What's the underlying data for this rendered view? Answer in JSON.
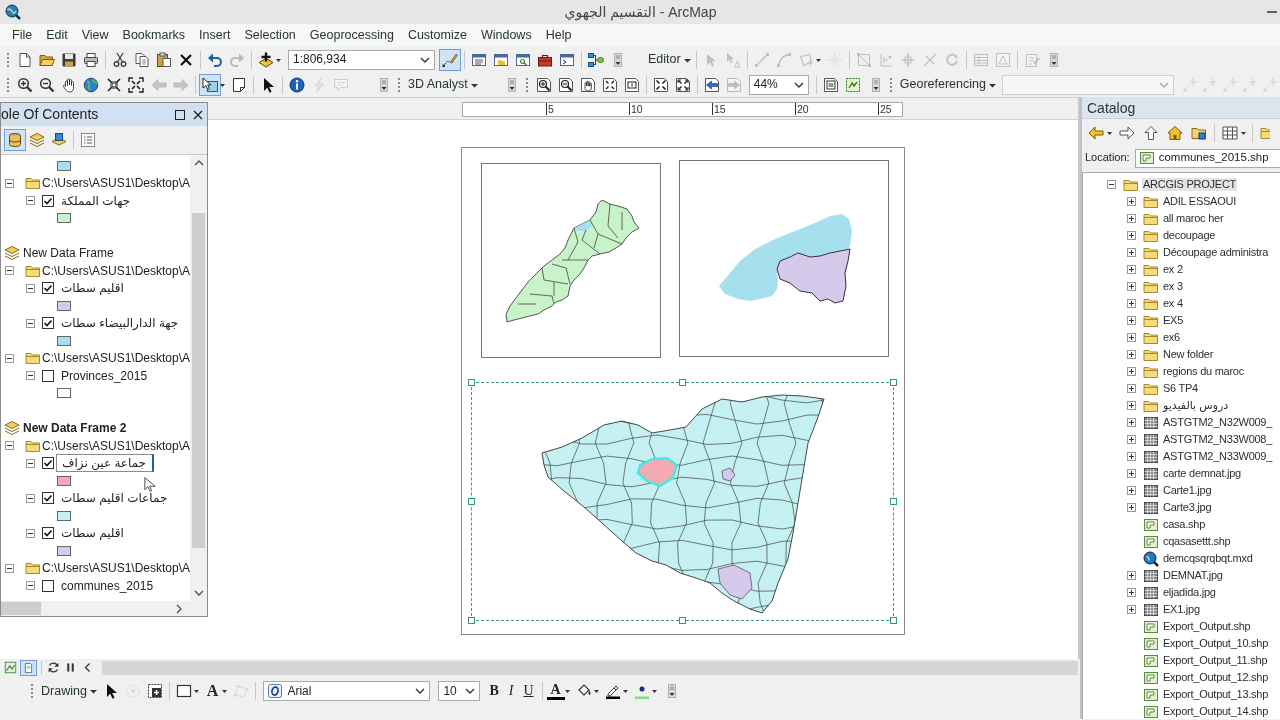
{
  "window": {
    "title": "التقسيم الجهوي - ArcMap"
  },
  "menu": [
    "File",
    "Edit",
    "View",
    "Bookmarks",
    "Insert",
    "Selection",
    "Geoprocessing",
    "Customize",
    "Windows",
    "Help"
  ],
  "toolbars": [
    {
      "items": [
        {
          "kind": "button",
          "disabled": false,
          "selected": false
        },
        {
          "kind": "button",
          "disabled": false,
          "selected": false
        },
        {
          "kind": "button",
          "disabled": false,
          "selected": false
        },
        {
          "kind": "button",
          "disabled": false,
          "selected": false
        },
        {
          "kind": "button",
          "disabled": false,
          "selected": false
        },
        {
          "kind": "button",
          "disabled": false,
          "selected": false
        },
        {
          "kind": "button",
          "disabled": false,
          "selected": false
        },
        {
          "kind": "button",
          "disabled": false,
          "selected": false
        },
        {
          "kind": "button",
          "disabled": false,
          "selected": false
        },
        {
          "kind": "button",
          "disabled": true,
          "selected": false
        },
        {
          "kind": "button",
          "disabled": false,
          "selected": false
        },
        {
          "kind": "combo",
          "value": "1:806,934",
          "disabled": false
        },
        {
          "kind": "button",
          "disabled": false,
          "selected": true
        },
        {
          "kind": "button",
          "disabled": false,
          "selected": false
        },
        {
          "kind": "button",
          "disabled": false,
          "selected": false
        },
        {
          "kind": "button",
          "disabled": false,
          "selected": false
        },
        {
          "kind": "button",
          "disabled": false,
          "selected": false
        },
        {
          "kind": "button",
          "disabled": false,
          "selected": false
        },
        {
          "kind": "button",
          "disabled": false,
          "selected": false
        },
        {
          "kind": "button",
          "disabled": false,
          "selected": false
        },
        {
          "kind": "menu",
          "label": "Editor"
        },
        {
          "kind": "button",
          "disabled": true,
          "selected": false
        },
        {
          "kind": "button",
          "disabled": true,
          "selected": false
        },
        {
          "kind": "button",
          "disabled": true,
          "selected": false
        },
        {
          "kind": "button",
          "disabled": true,
          "selected": false
        },
        {
          "kind": "button",
          "disabled": true,
          "selected": false
        },
        {
          "kind": "button",
          "disabled": true,
          "selected": false
        },
        {
          "kind": "button",
          "disabled": true,
          "selected": false
        },
        {
          "kind": "button",
          "disabled": true,
          "selected": false
        },
        {
          "kind": "button",
          "disabled": true,
          "selected": false
        },
        {
          "kind": "button",
          "disabled": true,
          "selected": false
        },
        {
          "kind": "button",
          "disabled": true,
          "selected": false
        },
        {
          "kind": "button",
          "disabled": true,
          "selected": false
        },
        {
          "kind": "button",
          "disabled": true,
          "selected": false
        },
        {
          "kind": "button",
          "disabled": true,
          "selected": false
        },
        {
          "kind": "button",
          "disabled": false,
          "selected": false
        }
      ]
    },
    {
      "items": [
        {
          "kind": "button",
          "disabled": false,
          "selected": false
        },
        {
          "kind": "button",
          "disabled": false,
          "selected": false
        },
        {
          "kind": "button",
          "disabled": false,
          "selected": false
        },
        {
          "kind": "button",
          "disabled": false,
          "selected": false
        },
        {
          "kind": "button",
          "disabled": false,
          "selected": false
        },
        {
          "kind": "button",
          "disabled": false,
          "selected": false
        },
        {
          "kind": "button",
          "disabled": true,
          "selected": false
        },
        {
          "kind": "button",
          "disabled": true,
          "selected": false
        },
        {
          "kind": "button",
          "disabled": false,
          "selected": true
        },
        {
          "kind": "button",
          "disabled": false,
          "selected": false
        },
        {
          "kind": "button",
          "disabled": false,
          "selected": false
        },
        {
          "kind": "button",
          "disabled": false,
          "selected": false
        },
        {
          "kind": "button",
          "disabled": true,
          "selected": false
        },
        {
          "kind": "button",
          "disabled": true,
          "selected": false
        },
        {
          "kind": "button",
          "disabled": false,
          "selected": false
        },
        {
          "kind": "menu",
          "label": "3D Analyst"
        },
        {
          "kind": "button",
          "disabled": false,
          "selected": false
        },
        {
          "kind": "button",
          "disabled": false,
          "selected": false
        },
        {
          "kind": "button",
          "disabled": false,
          "selected": false
        },
        {
          "kind": "button",
          "disabled": false,
          "selected": false
        },
        {
          "kind": "button",
          "disabled": false,
          "selected": false
        },
        {
          "kind": "button",
          "disabled": false,
          "selected": false
        },
        {
          "kind": "button",
          "disabled": false,
          "selected": false
        },
        {
          "kind": "button",
          "disabled": false,
          "selected": false
        },
        {
          "kind": "button",
          "disabled": false,
          "selected": false
        },
        {
          "kind": "button",
          "disabled": true,
          "selected": false
        },
        {
          "kind": "combo",
          "value": "44%",
          "disabled": false
        },
        {
          "kind": "button",
          "disabled": false,
          "selected": false
        },
        {
          "kind": "button",
          "disabled": false,
          "selected": false
        },
        {
          "kind": "button",
          "disabled": false,
          "selected": false
        },
        {
          "kind": "menu",
          "label": "Georeferencing"
        },
        {
          "kind": "combo",
          "disabled": true
        },
        {
          "kind": "button",
          "disabled": true,
          "selected": false
        },
        {
          "kind": "button",
          "disabled": true,
          "selected": false
        },
        {
          "kind": "button",
          "disabled": true,
          "selected": false
        },
        {
          "kind": "button",
          "disabled": true,
          "selected": false
        },
        {
          "kind": "button",
          "disabled": true,
          "selected": false
        }
      ]
    }
  ],
  "toc": {
    "title": "ole Of Contents",
    "toolbar": [
      {
        "kind": "button",
        "disabled": false,
        "selected": true
      },
      {
        "kind": "button",
        "disabled": false,
        "selected": false
      },
      {
        "kind": "button",
        "disabled": false,
        "selected": false
      },
      {
        "kind": "button",
        "disabled": false,
        "selected": false
      }
    ],
    "items": [
      {
        "kind": "frame",
        "children": [
          {
            "kind": "folder",
            "children": [
              {
                "kind": "layer",
                "color": "#a6e0ef"
              }
            ]
          },
          {
            "kind": "folder",
            "label": "C:\\Users\\ASUS1\\Desktop\\A",
            "expanded": true,
            "children": [
              {
                "kind": "layer",
                "label": "جهات المملكة",
                "checked": true,
                "expanded": true,
                "editing": false,
                "color": "#c8f2c8"
              }
            ]
          }
        ]
      },
      {
        "kind": "frame",
        "label": "New Data Frame",
        "active": false,
        "children": [
          {
            "kind": "folder",
            "label": "C:\\Users\\ASUS1\\Desktop\\A",
            "expanded": true,
            "children": [
              {
                "kind": "layer",
                "label": "اقليم سطات",
                "checked": true,
                "expanded": true,
                "editing": false,
                "color": "#d6caec"
              },
              {
                "kind": "layer",
                "label": "جهة الدارالبيضاء سطات",
                "checked": true,
                "expanded": true,
                "editing": false,
                "color": "#a6e0ef"
              }
            ]
          },
          {
            "kind": "folder",
            "label": "C:\\Users\\ASUS1\\Desktop\\A",
            "expanded": true,
            "children": [
              {
                "kind": "layer",
                "label": "Provinces_2015",
                "checked": false,
                "expanded": true,
                "editing": false,
                "color": "#ffffff"
              }
            ]
          }
        ]
      },
      {
        "kind": "frame",
        "label": "New Data Frame 2",
        "active": true,
        "children": [
          {
            "kind": "folder",
            "label": "C:\\Users\\ASUS1\\Desktop\\A",
            "expanded": true,
            "children": [
              {
                "kind": "layer",
                "label": "جماعة عين نزاف",
                "checked": true,
                "expanded": true,
                "editing": true,
                "color": "#f2aab3"
              },
              {
                "kind": "layer",
                "label": "جماعات اقليم سطات",
                "checked": true,
                "expanded": true,
                "editing": false,
                "color": "#c6f1f3"
              },
              {
                "kind": "layer",
                "label": "اقليم سطات",
                "checked": true,
                "expanded": true,
                "editing": false,
                "color": "#d6caec"
              }
            ]
          },
          {
            "kind": "folder",
            "label": "C:\\Users\\ASUS1\\Desktop\\A",
            "expanded": true,
            "children": [
              {
                "kind": "layer",
                "label": "communes_2015",
                "checked": false,
                "expanded": true,
                "editing": false
              }
            ]
          }
        ]
      }
    ]
  },
  "layout": {
    "ruler": [
      "5",
      "10",
      "15",
      "20",
      "25"
    ],
    "frames": [
      {
        "selected": false
      },
      {
        "selected": false
      },
      {
        "selected": true
      }
    ]
  },
  "view_bar": {
    "items": [
      {
        "kind": "button",
        "disabled": false,
        "selected": false
      },
      {
        "kind": "button",
        "disabled": false,
        "selected": true
      },
      {
        "kind": "button",
        "disabled": false,
        "selected": false
      },
      {
        "kind": "button",
        "disabled": false,
        "selected": false
      },
      {
        "kind": "button",
        "disabled": false,
        "selected": false
      }
    ]
  },
  "drawing_toolbar": {
    "items": [
      {
        "kind": "menu",
        "label": "Drawing"
      },
      {
        "kind": "button",
        "disabled": false,
        "selected": false
      },
      {
        "kind": "button",
        "disabled": true,
        "selected": false
      },
      {
        "kind": "button",
        "disabled": false,
        "selected": false
      },
      {
        "kind": "button",
        "disabled": false,
        "selected": false
      },
      {
        "kind": "text_button",
        "label": "A",
        "disabled": false,
        "selected": false
      },
      {
        "kind": "button",
        "disabled": true,
        "selected": false
      },
      {
        "kind": "combo",
        "value": "Arial",
        "disabled": false
      },
      {
        "kind": "combo",
        "value": "10",
        "disabled": false
      },
      {
        "kind": "text_button",
        "label": "B",
        "disabled": false,
        "selected": false
      },
      {
        "kind": "text_button",
        "label": "I",
        "disabled": false,
        "selected": false
      },
      {
        "kind": "text_button",
        "label": "U",
        "disabled": false,
        "selected": false
      },
      {
        "kind": "text_button",
        "label": "A",
        "disabled": false,
        "selected": false,
        "color": "#000000"
      },
      {
        "kind": "button",
        "disabled": false,
        "selected": false
      },
      {
        "kind": "button",
        "disabled": false,
        "selected": false,
        "color": "#000000"
      },
      {
        "kind": "button",
        "disabled": false,
        "selected": false,
        "color": "#7ee07a"
      },
      {
        "kind": "button",
        "disabled": false,
        "selected": false
      }
    ]
  },
  "catalog": {
    "title": "Catalog",
    "toolbar": [
      {
        "kind": "button",
        "disabled": false,
        "selected": false
      },
      {
        "kind": "button",
        "disabled": false,
        "selected": false
      },
      {
        "kind": "button",
        "disabled": false,
        "selected": false
      },
      {
        "kind": "button",
        "disabled": false,
        "selected": false
      },
      {
        "kind": "button",
        "disabled": false,
        "selected": false
      },
      {
        "kind": "button",
        "disabled": false,
        "selected": false
      },
      {
        "kind": "button",
        "disabled": false,
        "selected": false
      }
    ],
    "location_label": "Location:",
    "location": "communes_2015.shp",
    "tree": [
      {
        "kind": "folder",
        "label": "ARCGIS PROJECT",
        "expanded": true,
        "selected": true,
        "children": [
          {
            "kind": "folder",
            "label": "ADIL ESSAOUI",
            "expanded": false,
            "selected": false
          },
          {
            "kind": "folder",
            "label": "all maroc her",
            "expanded": false,
            "selected": false
          },
          {
            "kind": "folder",
            "label": "decoupage",
            "expanded": false,
            "selected": false
          },
          {
            "kind": "folder",
            "label": "Découpage administra",
            "expanded": false,
            "selected": false
          },
          {
            "kind": "folder",
            "label": "ex 2",
            "expanded": false,
            "selected": false
          },
          {
            "kind": "folder",
            "label": "ex 3",
            "expanded": false,
            "selected": false
          },
          {
            "kind": "folder",
            "label": "ex 4",
            "expanded": false,
            "selected": false
          },
          {
            "kind": "folder",
            "label": "EX5",
            "expanded": false,
            "selected": false
          },
          {
            "kind": "folder",
            "label": "ex6",
            "expanded": false,
            "selected": false
          },
          {
            "kind": "folder",
            "label": "New folder",
            "expanded": false,
            "selected": false
          },
          {
            "kind": "folder",
            "label": "regions du maroc",
            "expanded": false,
            "selected": false
          },
          {
            "kind": "folder",
            "label": "S6 TP4",
            "expanded": false,
            "selected": false
          },
          {
            "kind": "folder",
            "label": "دروس بالفيديو",
            "expanded": false,
            "selected": false
          },
          {
            "kind": "raster",
            "label": "ASTGTM2_N32W009_",
            "expanded": false,
            "selected": false
          },
          {
            "kind": "raster",
            "label": "ASTGTM2_N33W008_",
            "expanded": false,
            "selected": false
          },
          {
            "kind": "raster",
            "label": "ASTGTM2_N33W009_",
            "expanded": false,
            "selected": false
          },
          {
            "kind": "raster",
            "label": "carte demnat.jpg",
            "expanded": false,
            "selected": false
          },
          {
            "kind": "raster",
            "label": "Carte1.jpg",
            "expanded": false,
            "selected": false
          },
          {
            "kind": "raster",
            "label": "Carte3.jpg",
            "expanded": false,
            "selected": false
          },
          {
            "kind": "shapefile",
            "label": "casa.shp",
            "selected": false
          },
          {
            "kind": "shapefile",
            "label": "cqasasettt.shp",
            "selected": false
          },
          {
            "kind": "map_document",
            "label": "demcqsqrqbqt.mxd",
            "selected": false
          },
          {
            "kind": "raster",
            "label": "DEMNAT.jpg",
            "expanded": false,
            "selected": false
          },
          {
            "kind": "raster",
            "label": "eljadida.jpg",
            "expanded": false,
            "selected": false
          },
          {
            "kind": "raster",
            "label": "EX1.jpg",
            "expanded": false,
            "selected": false
          },
          {
            "kind": "shapefile",
            "label": "Export_Output.shp",
            "selected": false
          },
          {
            "kind": "shapefile",
            "label": "Export_Output_10.shp",
            "selected": false
          },
          {
            "kind": "shapefile",
            "label": "Export_Output_11.shp",
            "selected": false
          },
          {
            "kind": "shapefile",
            "label": "Export_Output_12.shp",
            "selected": false
          },
          {
            "kind": "shapefile",
            "label": "Export_Output_13.shp",
            "selected": false
          },
          {
            "kind": "shapefile",
            "label": "Export_Output_14.shp",
            "selected": false
          }
        ]
      }
    ]
  }
}
